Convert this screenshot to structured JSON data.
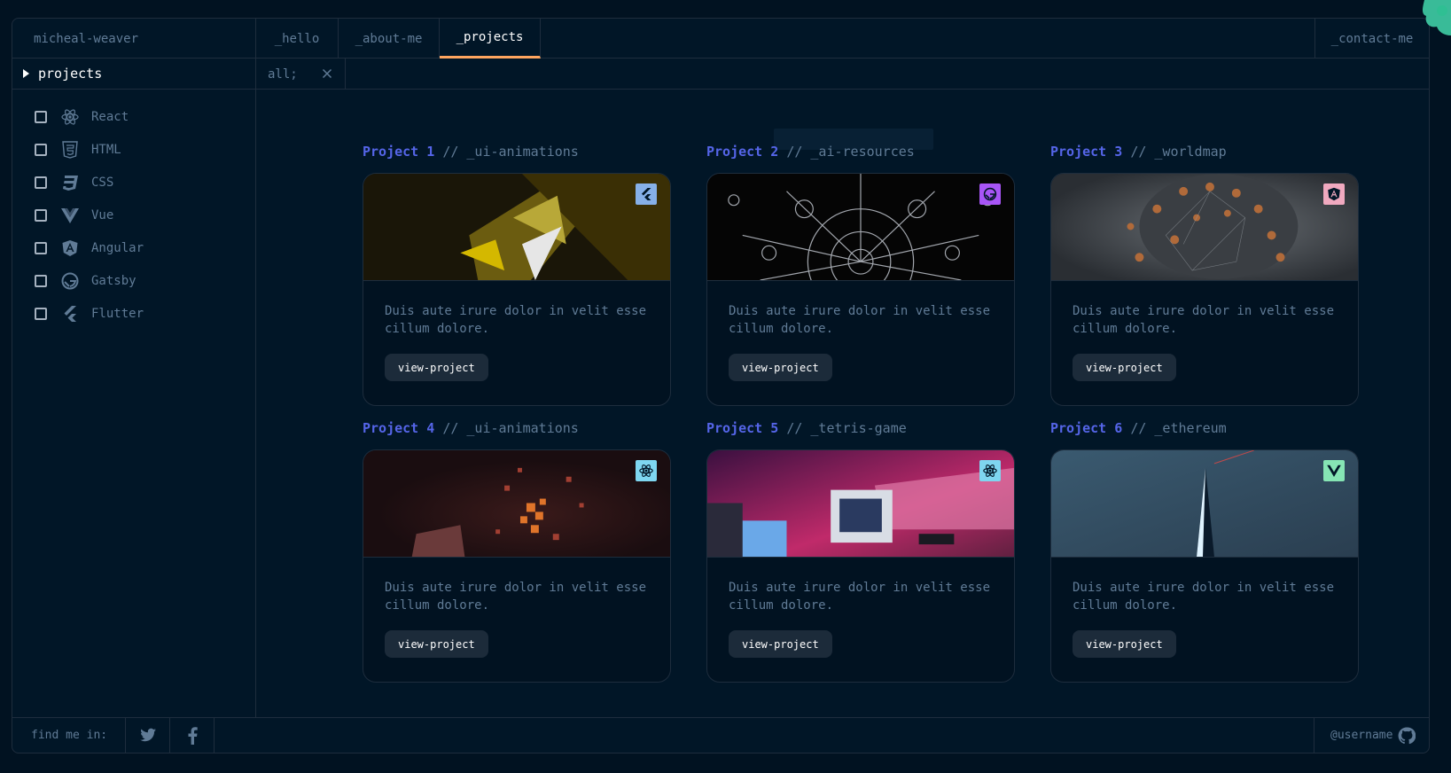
{
  "brand": "micheal-weaver",
  "nav": {
    "tabs": [
      {
        "label": "_hello"
      },
      {
        "label": "_about-me"
      },
      {
        "label": "_projects"
      }
    ],
    "contact": "_contact-me",
    "active": "_projects"
  },
  "sidebar": {
    "heading": "projects",
    "items": [
      {
        "label": "React",
        "icon": "react-icon",
        "checked": false
      },
      {
        "label": "HTML",
        "icon": "html-icon",
        "checked": false
      },
      {
        "label": "CSS",
        "icon": "css-icon",
        "checked": false
      },
      {
        "label": "Vue",
        "icon": "vue-icon",
        "checked": false
      },
      {
        "label": "Angular",
        "icon": "angular-icon",
        "checked": false
      },
      {
        "label": "Gatsby",
        "icon": "gatsby-icon",
        "checked": false
      },
      {
        "label": "Flutter",
        "icon": "flutter-icon",
        "checked": false
      }
    ]
  },
  "filter": {
    "label": "all;"
  },
  "projects": [
    {
      "num": "Project 1",
      "name": "// _ui-animations",
      "desc": "Duis aute irure dolor in velit esse cillum dolore.",
      "button": "view-project",
      "tech_icon": "flutter-icon",
      "badge_color": "#86b0e8"
    },
    {
      "num": "Project 2",
      "name": "// _ai-resources",
      "desc": "Duis aute irure dolor in velit esse cillum dolore.",
      "button": "view-project",
      "tech_icon": "gatsby-icon",
      "badge_color": "#a855f7"
    },
    {
      "num": "Project 3",
      "name": "// _worldmap",
      "desc": "Duis aute irure dolor in velit esse cillum dolore.",
      "button": "view-project",
      "tech_icon": "angular-icon",
      "badge_color": "#f0a9bf"
    },
    {
      "num": "Project 4",
      "name": "// _ui-animations",
      "desc": "Duis aute irure dolor in velit esse cillum dolore.",
      "button": "view-project",
      "tech_icon": "react-icon",
      "badge_color": "#7ed6f0"
    },
    {
      "num": "Project 5",
      "name": "// _tetris-game",
      "desc": "Duis aute irure dolor in velit esse cillum dolore.",
      "button": "view-project",
      "tech_icon": "react-icon",
      "badge_color": "#7ed6f0"
    },
    {
      "num": "Project 6",
      "name": "// _ethereum",
      "desc": "Duis aute irure dolor in velit esse cillum dolore.",
      "button": "view-project",
      "tech_icon": "vue-icon",
      "badge_color": "#86e5b4"
    }
  ],
  "footer": {
    "find_label": "find me in:",
    "social": [
      "twitter-icon",
      "facebook-icon"
    ],
    "username": "@username"
  },
  "colors": {
    "background": "#011221",
    "panel": "#011627",
    "border": "#1e2d3d",
    "text": "#607b96",
    "accent": "#fea55f",
    "project_number": "#5565e8",
    "button_bg": "#1c2b3a"
  }
}
